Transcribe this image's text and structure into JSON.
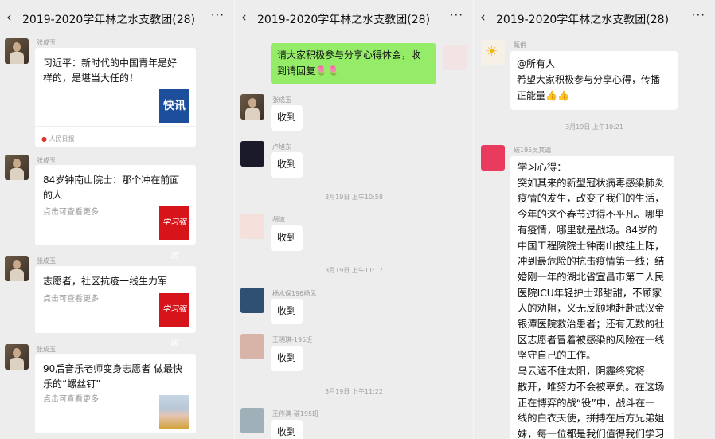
{
  "chat_title": "2019-2020学年林之水支教团(28)",
  "icons": {
    "back": "back-chevron-icon",
    "more": "more-dots-icon"
  },
  "panel1": {
    "messages": [
      {
        "sender": "张成玉",
        "title_lines": [
          "习近平：新时代的中国青年是好",
          "样的，是堪当大任的！"
        ],
        "thumb": "快讯",
        "source": "人民日报"
      },
      {
        "sender": "张成玉",
        "title_lines": [
          "84岁钟南山院士：那个冲在前面",
          "的人"
        ],
        "sub": "点击可查看更多",
        "thumb": "学习强国"
      },
      {
        "sender": "张成玉",
        "title_lines": [
          "志愿者，社区抗疫一线生力军"
        ],
        "sub": "点击可查看更多",
        "thumb": "学习强国"
      },
      {
        "sender": "张成玉",
        "title_lines": [
          "90后音乐老师变身志愿者 做最快",
          "乐的“螺丝钉”"
        ],
        "sub": "点击可查看更多"
      }
    ]
  },
  "panel2": {
    "green_msg_lines": [
      "请大家积极参与分享心得体会，收",
      "到请回复🌷🌷"
    ],
    "replies": [
      {
        "sender": "张成玉",
        "text": "收到"
      },
      {
        "sender": "卢旭东",
        "text": "收到"
      },
      {
        "sender": "胡波",
        "text": "收到"
      },
      {
        "sender": "杨水保196杨凤",
        "text": "收到"
      },
      {
        "sender": "王明琪-195班",
        "text": "收到"
      },
      {
        "sender": "王作满-碳195班",
        "text": "收到"
      }
    ],
    "times": [
      "3月19日 上午10:58",
      "3月19日 上午11:17",
      "3月19日 上午11:22"
    ]
  },
  "panel3": {
    "sender1": "甄俏",
    "msg1_lines": [
      "@所有人",
      "希望大家积极参与分享心得，传播",
      "正能量👍👍"
    ],
    "time": "3月19日 上午10:21",
    "sender2": "碳195吴其逵",
    "long_lines": [
      "学习心得：",
      "突如其来的新型冠状病毒感染肺炎",
      "疫情的发生，改变了我们的生活，",
      "今年的这个春节过得不平凡。哪里",
      "有疫情，哪里就是战场。84岁的",
      "中国工程院院士钟南山披挂上阵，",
      "冲到最危险的抗击疫情第一线；结",
      "婚刚一年的湖北省宜昌市第二人民",
      "医院ICU年轻护士邓甜甜，不顾家",
      "人的劝阻，义无反顾地赶赴武汉金",
      "银潭医院救治患者；还有无数的社",
      "区志愿者冒着被感染的风险在一线",
      "坚守自己的工作。",
      "    乌云遮不住太阳，阴霾终究将",
      "散开，唯努力不会被辜负。在这场",
      "正在博弈的战“役”中，战斗在一",
      "线的白衣天使，拼搏在后方兄弟姐",
      "妹，每一位都是我们值得我们学习",
      "的伟大榜样！我们有理由坚信：有"
    ]
  }
}
